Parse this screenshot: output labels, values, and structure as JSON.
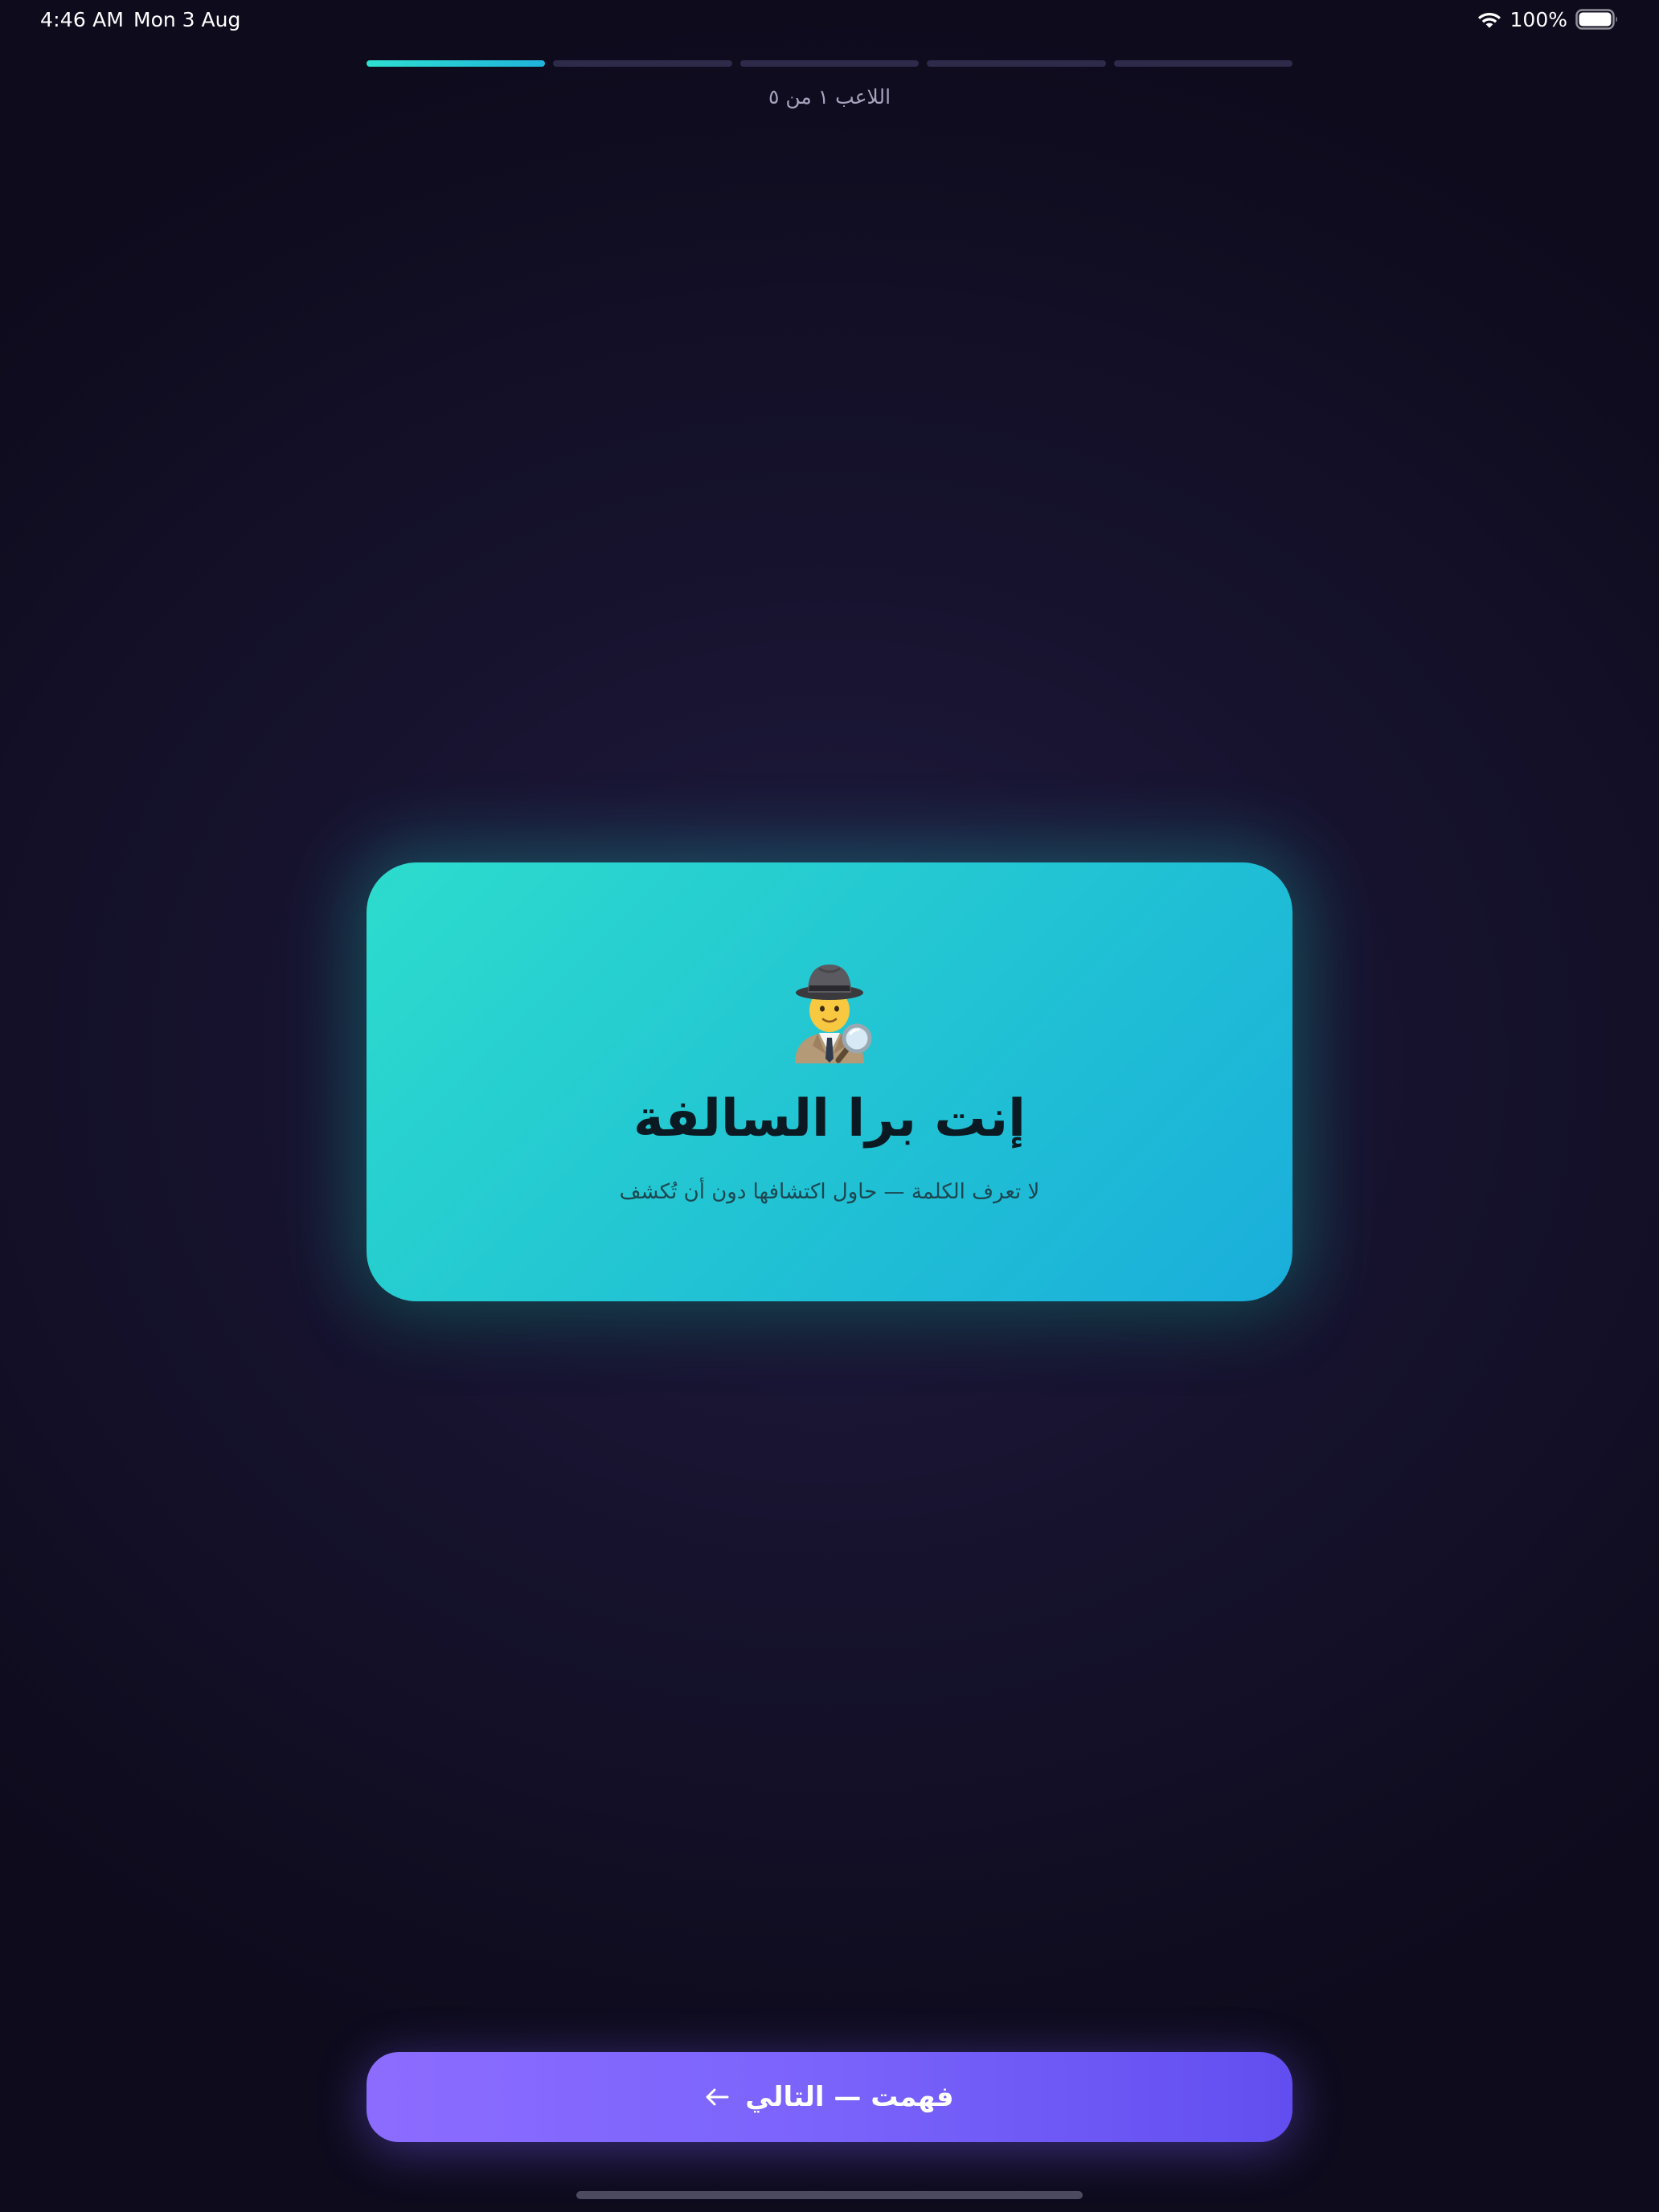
{
  "status_bar": {
    "time": "4:46 AM",
    "date": "Mon 3 Aug",
    "battery_percent": "100%",
    "battery_level": 1.0,
    "wifi_icon": "wifi-icon",
    "battery_icon": "battery-icon"
  },
  "progress": {
    "current_player": 1,
    "total_players": 5,
    "label": "اللاعب ١ من ٥",
    "active_color": "#2ee0cf",
    "inactive_color": "#2e2a4a"
  },
  "role_card": {
    "emoji": "detective-icon",
    "title": "إنت برا السالفة",
    "subtitle": "لا تعرف الكلمة — حاول اكتشافها دون أن تُكشف",
    "gradient_start": "#2ddccd",
    "gradient_end": "#1aaedb"
  },
  "next_button": {
    "label": "فهمت — التالي",
    "icon": "arrow-left-icon",
    "color_start": "#8c6cff",
    "color_end": "#624ef0"
  },
  "background_color": "#17132f"
}
